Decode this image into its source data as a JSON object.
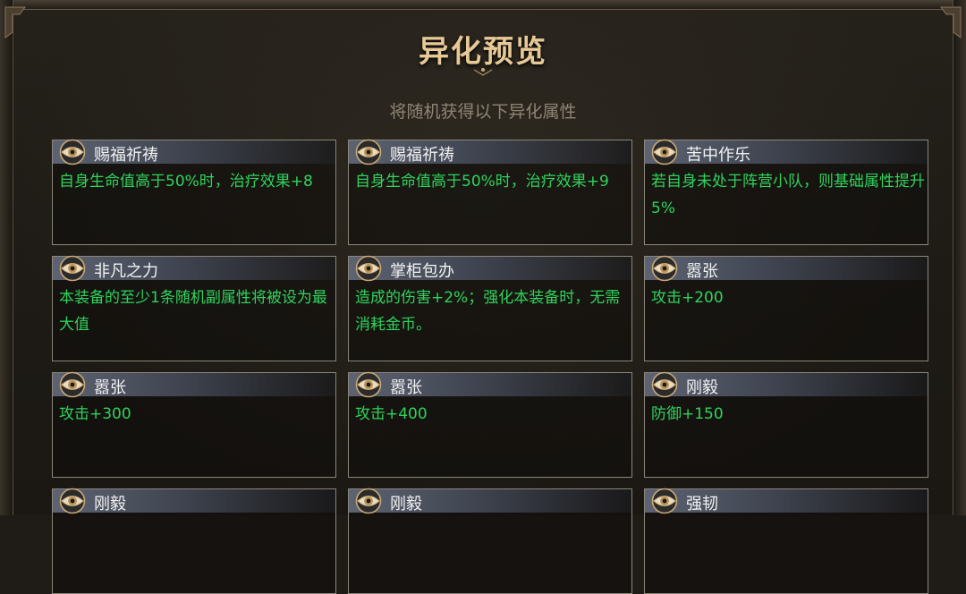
{
  "title": "异化预览",
  "subtitle": "将随机获得以下异化属性",
  "cards": [
    {
      "name": "赐福祈祷",
      "desc": "自身生命值高于50%时，治疗效果+8"
    },
    {
      "name": "赐福祈祷",
      "desc": "自身生命值高于50%时，治疗效果+9"
    },
    {
      "name": "苦中作乐",
      "desc": "若自身未处于阵营小队，则基础属性提升5%"
    },
    {
      "name": "非凡之力",
      "desc": "本装备的至少1条随机副属性将被设为最大值"
    },
    {
      "name": "掌柜包办",
      "desc": "造成的伤害+2%；强化本装备时，无需消耗金币。"
    },
    {
      "name": "嚣张",
      "desc": "攻击+200"
    },
    {
      "name": "嚣张",
      "desc": "攻击+300"
    },
    {
      "name": "嚣张",
      "desc": "攻击+400"
    },
    {
      "name": "刚毅",
      "desc": "防御+150"
    },
    {
      "name": "刚毅",
      "desc": ""
    },
    {
      "name": "刚毅",
      "desc": ""
    },
    {
      "name": "强韧",
      "desc": ""
    }
  ],
  "colors": {
    "title": "#e7c996",
    "desc": "#2fd35c",
    "name": "#f2f2f2",
    "subtitle": "#8e8674"
  },
  "icons": {
    "card_icon": "eye-icon"
  }
}
